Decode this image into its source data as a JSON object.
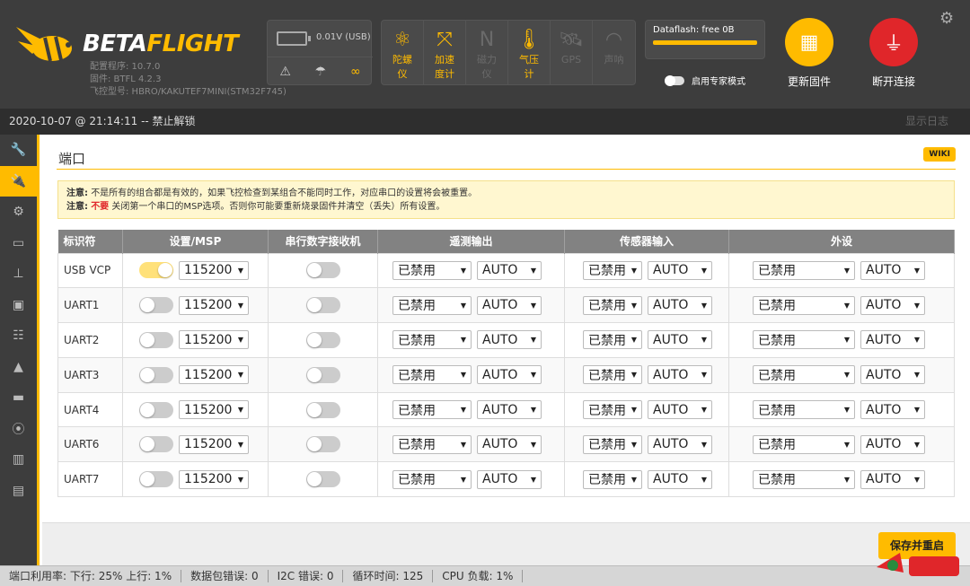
{
  "brand": {
    "name_a": "BETA",
    "name_b": "FLIGHT"
  },
  "firmware": {
    "configurator": "配置程序: 10.7.0",
    "firmware": "固件: BTFL 4.2.3",
    "board": "飞控型号: HBRO/KAKUTEF7MINI(STM32F745)"
  },
  "battery": {
    "text": "0.01V (USB)"
  },
  "sensors": [
    {
      "icon": "gyro-icon",
      "glyph": "⚛",
      "label": "陀螺仪",
      "active": true
    },
    {
      "icon": "accelerometer-icon",
      "glyph": "⤧",
      "label": "加速度计",
      "active": true
    },
    {
      "icon": "magnetometer-icon",
      "glyph": "N",
      "label": "磁力仪",
      "active": false
    },
    {
      "icon": "barometer-icon",
      "glyph": "🌡",
      "label": "气压计",
      "active": true
    },
    {
      "icon": "gps-icon",
      "glyph": "🛰",
      "label": "GPS",
      "active": false
    },
    {
      "icon": "sonar-icon",
      "glyph": "◠",
      "label": "声呐",
      "active": false
    }
  ],
  "dataflash": {
    "label": "Dataflash: free 0B"
  },
  "expert_mode": {
    "label": "启用专家模式"
  },
  "buttons": {
    "update_firmware": "更新固件",
    "disconnect": "断开连接"
  },
  "status_line": {
    "text": "2020-10-07 @ 21:14:11 -- 禁止解锁",
    "show_log": "显示日志"
  },
  "nav": [
    {
      "icon": "wrench-icon",
      "glyph": "🔧",
      "active": false
    },
    {
      "icon": "plug-icon",
      "glyph": "🔌",
      "active": true
    },
    {
      "icon": "gear-icon",
      "glyph": "⚙",
      "active": false
    },
    {
      "icon": "battery-icon",
      "glyph": "▭",
      "active": false
    },
    {
      "icon": "failsafe-icon",
      "glyph": "⊥",
      "active": false
    },
    {
      "icon": "receiver-icon",
      "glyph": "▣",
      "active": false
    },
    {
      "icon": "modes-icon",
      "glyph": "☷",
      "active": false
    },
    {
      "icon": "adjustments-icon",
      "glyph": "▲",
      "active": false
    },
    {
      "icon": "osd-icon",
      "glyph": "▬",
      "active": false
    },
    {
      "icon": "video-tx-icon",
      "glyph": "⦿",
      "active": false
    },
    {
      "icon": "led-strip-icon",
      "glyph": "▥",
      "active": false
    },
    {
      "icon": "cli-icon",
      "glyph": "▤",
      "active": false
    }
  ],
  "page": {
    "title": "端口",
    "wiki": "WIKI",
    "note_label_1": "注意:",
    "note_text_1": "不是所有的组合都是有效的，如果飞控检查到某组合不能同时工作，对应串口的设置将会被重置。",
    "note_label_2": "注意:",
    "note_warn_2": "不要",
    "note_text_2": "关闭第一个串口的MSP选项。否则你可能要重新烧录固件并清空（丢失）所有设置。"
  },
  "table": {
    "headers": [
      "标识符",
      "设置/MSP",
      "串行数字接收机",
      "遥测输出",
      "传感器输入",
      "外设"
    ],
    "rows": [
      {
        "id": "USB VCP",
        "msp": true,
        "baud": "115200",
        "rx": false,
        "tel": "已禁用",
        "tel_baud": "AUTO",
        "sens": "已禁用",
        "sens_baud": "AUTO",
        "per": "已禁用",
        "per_baud": "AUTO"
      },
      {
        "id": "UART1",
        "msp": false,
        "baud": "115200",
        "rx": false,
        "tel": "已禁用",
        "tel_baud": "AUTO",
        "sens": "已禁用",
        "sens_baud": "AUTO",
        "per": "已禁用",
        "per_baud": "AUTO"
      },
      {
        "id": "UART2",
        "msp": false,
        "baud": "115200",
        "rx": false,
        "tel": "已禁用",
        "tel_baud": "AUTO",
        "sens": "已禁用",
        "sens_baud": "AUTO",
        "per": "已禁用",
        "per_baud": "AUTO"
      },
      {
        "id": "UART3",
        "msp": false,
        "baud": "115200",
        "rx": false,
        "tel": "已禁用",
        "tel_baud": "AUTO",
        "sens": "已禁用",
        "sens_baud": "AUTO",
        "per": "已禁用",
        "per_baud": "AUTO"
      },
      {
        "id": "UART4",
        "msp": false,
        "baud": "115200",
        "rx": false,
        "tel": "已禁用",
        "tel_baud": "AUTO",
        "sens": "已禁用",
        "sens_baud": "AUTO",
        "per": "已禁用",
        "per_baud": "AUTO"
      },
      {
        "id": "UART6",
        "msp": false,
        "baud": "115200",
        "rx": false,
        "tel": "已禁用",
        "tel_baud": "AUTO",
        "sens": "已禁用",
        "sens_baud": "AUTO",
        "per": "已禁用",
        "per_baud": "AUTO"
      },
      {
        "id": "UART7",
        "msp": false,
        "baud": "115200",
        "rx": false,
        "tel": "已禁用",
        "tel_baud": "AUTO",
        "sens": "已禁用",
        "sens_baud": "AUTO",
        "per": "已禁用",
        "per_baud": "AUTO"
      }
    ]
  },
  "save_button": "保存并重启",
  "footer": [
    "端口利用率:  下行: 25% 上行: 1%",
    "数据包错误: 0",
    "I2C 错误: 0",
    "循环时间: 125",
    "CPU 负载: 1%"
  ],
  "colors": {
    "accent": "#ffbb00",
    "danger": "#e0262a",
    "header": "#3d3d3d"
  }
}
